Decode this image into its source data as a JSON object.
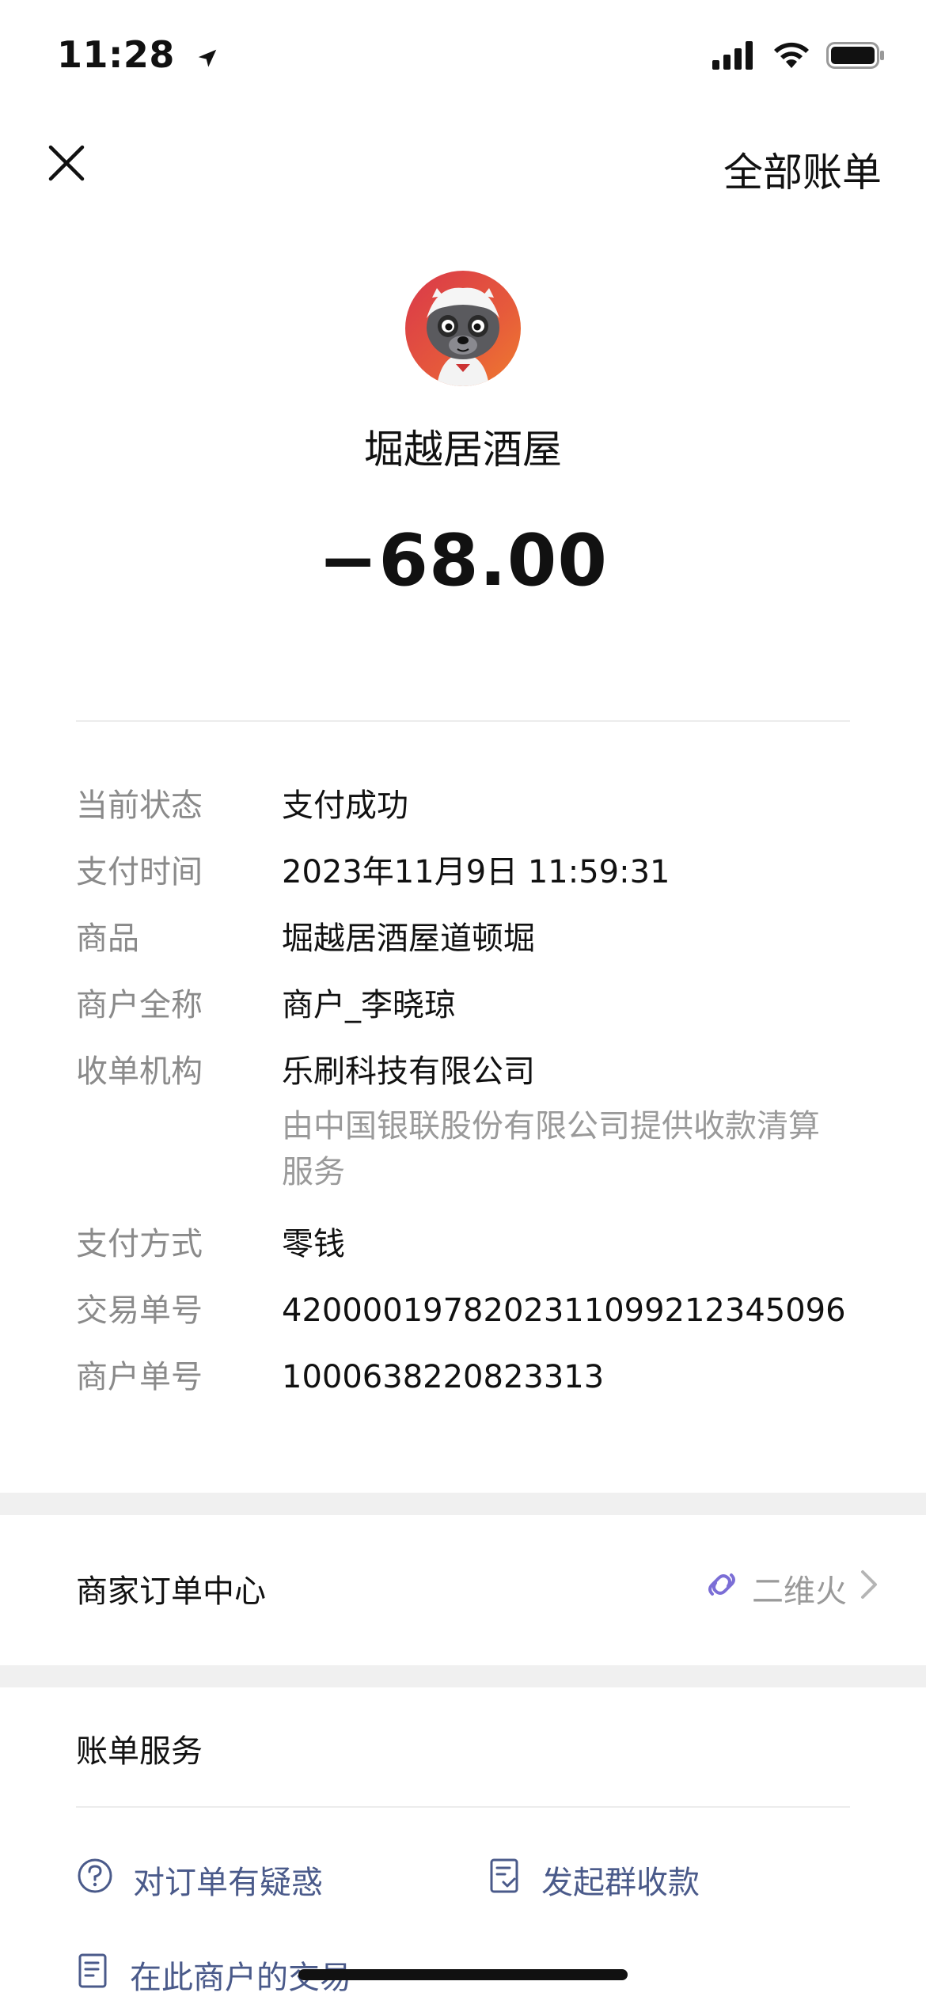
{
  "status_bar": {
    "time": "11:28"
  },
  "nav": {
    "all_bills": "全部账单"
  },
  "merchant": {
    "name": "堀越居酒屋",
    "amount": "−68.00"
  },
  "details": [
    {
      "label": "当前状态",
      "value": "支付成功"
    },
    {
      "label": "支付时间",
      "value": "2023年11月9日 11:59:31"
    },
    {
      "label": "商品",
      "value": "堀越居酒屋道顿堀"
    },
    {
      "label": "商户全称",
      "value": "商户_李晓琼"
    },
    {
      "label": "收单机构",
      "value": "乐刷科技有限公司",
      "sub": "由中国银联股份有限公司提供收款清算服务"
    },
    {
      "label": "支付方式",
      "value": "零钱"
    },
    {
      "label": "交易单号",
      "value": "4200001978202311099212345096"
    },
    {
      "label": "商户单号",
      "value": "1000638220823313"
    }
  ],
  "order_center": {
    "title": "商家订单中心",
    "link_text": "二维火"
  },
  "bill_service": {
    "title": "账单服务",
    "question": "对订单有疑惑",
    "group_collect": "发起群收款",
    "merchant_trades": "在此商户的交易"
  },
  "colors": {
    "link": "#4a5a8a",
    "avatar_bg": "#e04a40",
    "secondary": "#8a8a8a"
  }
}
